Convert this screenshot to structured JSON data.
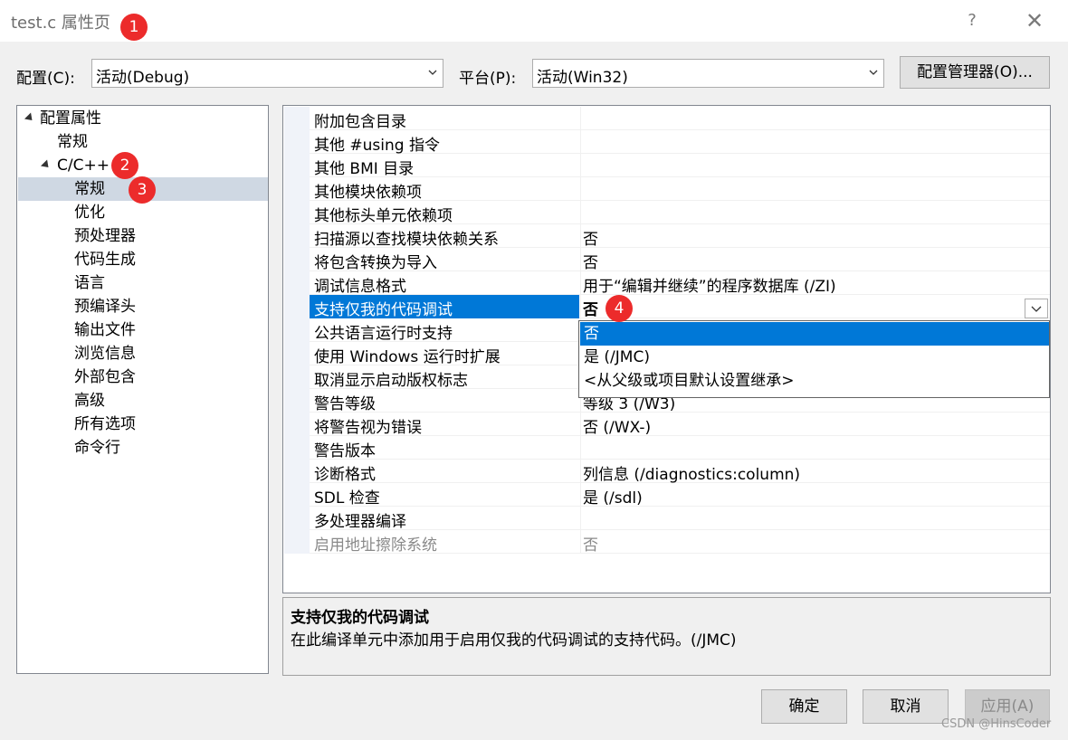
{
  "window": {
    "title": "test.c 属性页",
    "help": "?",
    "close": "✕"
  },
  "badges": [
    "1",
    "2",
    "3",
    "4"
  ],
  "config": {
    "label": "配置(C):",
    "value": "活动(Debug)"
  },
  "platform": {
    "label": "平台(P):",
    "value": "活动(Win32)"
  },
  "config_manager_button": "配置管理器(O)...",
  "tree": [
    {
      "label": "配置属性",
      "level": 0,
      "expanded": true
    },
    {
      "label": "常规",
      "level": 1
    },
    {
      "label": "C/C++",
      "level": 1,
      "expanded": true
    },
    {
      "label": "常规",
      "level": 2,
      "selected": true
    },
    {
      "label": "优化",
      "level": 2
    },
    {
      "label": "预处理器",
      "level": 2
    },
    {
      "label": "代码生成",
      "level": 2
    },
    {
      "label": "语言",
      "level": 2
    },
    {
      "label": "预编译头",
      "level": 2
    },
    {
      "label": "输出文件",
      "level": 2
    },
    {
      "label": "浏览信息",
      "level": 2
    },
    {
      "label": "外部包含",
      "level": 2
    },
    {
      "label": "高级",
      "level": 2
    },
    {
      "label": "所有选项",
      "level": 2
    },
    {
      "label": "命令行",
      "level": 2
    }
  ],
  "properties": [
    {
      "name": "附加包含目录",
      "value": ""
    },
    {
      "name": "其他 #using 指令",
      "value": ""
    },
    {
      "name": "其他 BMI 目录",
      "value": ""
    },
    {
      "name": "其他模块依赖项",
      "value": ""
    },
    {
      "name": "其他标头单元依赖项",
      "value": ""
    },
    {
      "name": "扫描源以查找模块依赖关系",
      "value": "否"
    },
    {
      "name": "将包含转换为导入",
      "value": "否"
    },
    {
      "name": "调试信息格式",
      "value": "用于“编辑并继续”的程序数据库 (/ZI)"
    },
    {
      "name": "支持仅我的代码调试",
      "value": "否",
      "selected": true
    },
    {
      "name": "公共语言运行时支持",
      "value": ""
    },
    {
      "name": "使用 Windows 运行时扩展",
      "value": ""
    },
    {
      "name": "取消显示启动版权标志",
      "value": ""
    },
    {
      "name": "警告等级",
      "value": "等级 3 (/W3)"
    },
    {
      "name": "将警告视为错误",
      "value": "否 (/WX-)"
    },
    {
      "name": "警告版本",
      "value": ""
    },
    {
      "name": "诊断格式",
      "value": "列信息 (/diagnostics:column)"
    },
    {
      "name": "SDL 检查",
      "value": "是 (/sdl)"
    },
    {
      "name": "多处理器编译",
      "value": ""
    },
    {
      "name": "启用地址擦除系统",
      "value": "否",
      "disabled": true
    }
  ],
  "dropdown_options": [
    {
      "label": "否",
      "highlighted": true
    },
    {
      "label": "是 (/JMC)"
    },
    {
      "label": "<从父级或项目默认设置继承>"
    }
  ],
  "description": {
    "title": "支持仅我的代码调试",
    "body": "在此编译单元中添加用于启用仅我的代码调试的支持代码。(/JMC)"
  },
  "buttons": {
    "ok": "确定",
    "cancel": "取消",
    "apply": "应用(A)"
  },
  "watermark": "CSDN @HinsCoder",
  "colors": {
    "selection": "#0078d7",
    "badge": "#ec2b2b",
    "tree_selection": "#cfd8e3"
  }
}
